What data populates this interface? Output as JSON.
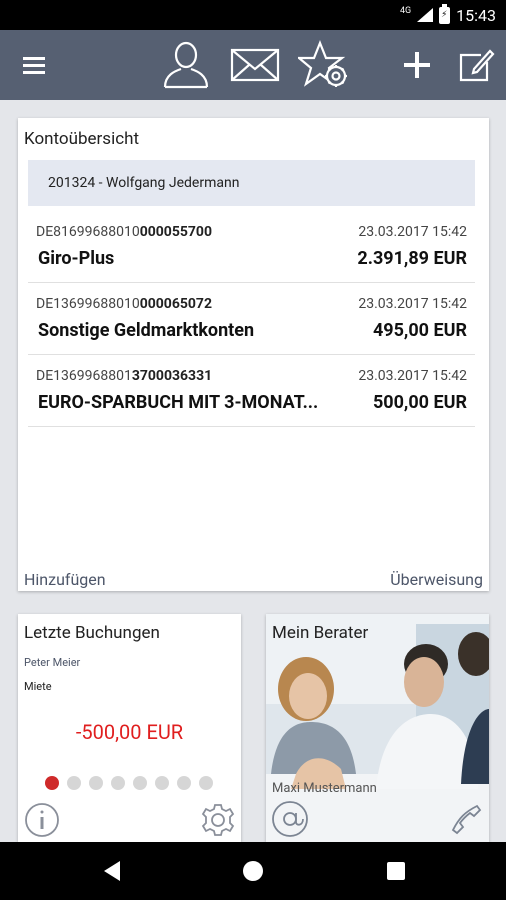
{
  "status_bar": {
    "network": "4G",
    "time": "15:43"
  },
  "app_bar": {
    "icons": [
      "menu-icon",
      "person-icon",
      "mail-icon",
      "star-settings-icon",
      "add-icon",
      "edit-icon"
    ]
  },
  "accounts": {
    "title": "Kontoübersicht",
    "owner": "201324 - Wolfgang Jedermann",
    "rows": [
      {
        "iban_prefix": "DE81699688010",
        "iban_suffix": "000055700",
        "date": "23.03.2017 15:42",
        "name": "Giro-Plus",
        "amount": "2.391,89 EUR"
      },
      {
        "iban_prefix": "DE13699688010",
        "iban_suffix": "000065072",
        "date": "23.03.2017 15:42",
        "name": "Sonstige Geldmarktkonten",
        "amount": "495,00 EUR"
      },
      {
        "iban_prefix": "DE1369968801",
        "iban_suffix": "3700036331",
        "date": "23.03.2017 15:42",
        "name": "EURO-SPARBUCH MIT 3-MONAT...",
        "amount": "500,00 EUR"
      }
    ],
    "add_label": "Hinzufügen",
    "transfer_label": "Überweisung"
  },
  "bookings": {
    "title": "Letzte Buchungen",
    "counterparty": "Peter Meier",
    "purpose": "Miete",
    "amount": "-500,00 EUR",
    "amount_color": "#e01e1e",
    "page_count": 8,
    "active_page": 1
  },
  "advisor": {
    "title": "Mein Berater",
    "name": "Maxi Mustermann"
  },
  "colors": {
    "app_bar": "#566072",
    "accent_text": "#4d5669",
    "negative": "#e01e1e",
    "active_dot": "#cf2a2a"
  }
}
